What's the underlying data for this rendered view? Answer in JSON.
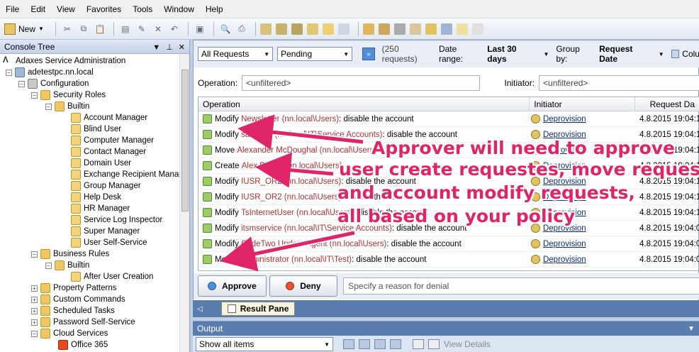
{
  "menu": [
    "File",
    "Edit",
    "View",
    "Favorites",
    "Tools",
    "Window",
    "Help"
  ],
  "toolbar": {
    "new_label": "New"
  },
  "tree": {
    "title": "Console Tree",
    "nodes": [
      "Adaxes Service Administration",
      "adetestpc.nn.local",
      "Configuration",
      "Security Roles",
      "Builtin",
      "Account Manager",
      "Blind User",
      "Computer Manager",
      "Contact Manager",
      "Domain User",
      "Exchange Recipient Manage",
      "Group Manager",
      "Help Desk",
      "HR Manager",
      "Service Log Inspector",
      "Super Manager",
      "User Self-Service",
      "Business Rules",
      "Builtin",
      "After User Creation",
      "Property Patterns",
      "Custom Commands",
      "Scheduled Tasks",
      "Password Self-Service",
      "Cloud Services",
      "Office 365"
    ]
  },
  "filter": {
    "requests_select": "All Requests",
    "status_select": "Pending",
    "count": "(250 requests)",
    "date_range_label": "Date range:",
    "date_range_value": "Last 30 days",
    "group_by_label": "Group by:",
    "group_by_value": "Request Date",
    "columns_label": "Colu",
    "operation_label": "Operation:",
    "operation_value": "<unfiltered>",
    "initiator_label": "Initiator:",
    "initiator_value": "<unfiltered>"
  },
  "grid": {
    "headers": [
      "Operation",
      "Initiator",
      "Request Da"
    ],
    "rows": [
      {
        "verb": "Modify",
        "obj": "Newsletter (nn.local\\Users)",
        "rest": ": disable the account",
        "initiator": "Deprovision",
        "date": "4.8.2015 19:04:1"
      },
      {
        "verb": "Modify",
        "obj": "saratuch (nn.local\\IT\\Service Accounts)",
        "rest": ": disable the account",
        "initiator": "Deprovision",
        "date": "4.8.2015 19:04:1"
      },
      {
        "verb": "Move",
        "obj": "Alexander McDoughal (nn.local\\Users)",
        "rest": ": to ...",
        "initiator": "Deprovision",
        "date": "4.8.2015 19:04:1"
      },
      {
        "verb": "Create",
        "obj": "Alex Brown (nn.local\\Users)",
        "rest": "",
        "initiator": "Deprovision",
        "date": "4.8.2015 19:04:1"
      },
      {
        "verb": "Modify",
        "obj": "IUSR_OR2 (nn.local\\Users)",
        "rest": ": disable the account",
        "initiator": "Deprovision",
        "date": "4.8.2015 19:04:1"
      },
      {
        "verb": "Modify",
        "obj": "IUSR_OR2 (nn.local\\Users)",
        "rest": ": disable the account",
        "initiator": "Deprovision",
        "date": "4.8.2015 19:04:1"
      },
      {
        "verb": "Modify",
        "obj": "TsInternetUser (nn.local\\Users)",
        "rest": ": disable the account",
        "initiator": "Deprovision",
        "date": "4.8.2015 19:04:1"
      },
      {
        "verb": "Modify",
        "obj": "itsmservice (nn.local\\IT\\Service Accounts)",
        "rest": ": disable the account",
        "initiator": "Deprovision",
        "date": "4.8.2015 19:04:0"
      },
      {
        "verb": "Modify",
        "obj": "CodeTwo Update Agent (nn.local\\Users)",
        "rest": ": disable the account",
        "initiator": "Deprovision",
        "date": "4.8.2015 19:04:0"
      },
      {
        "verb": "Modify",
        "obj": "Administrator (nn.local\\IT\\Test)",
        "rest": ": disable the account",
        "initiator": "Deprovision",
        "date": "4.8.2015 19:04:0"
      }
    ]
  },
  "actions": {
    "approve": "Approve",
    "deny": "Deny",
    "reason_placeholder": "Specify a reason for denial"
  },
  "result_tab": "Result Pane",
  "output": {
    "title": "Output",
    "filter": "Show all items",
    "view_details": "View Details"
  },
  "annotation": {
    "lines": [
      "Approver will need to approve",
      "user create requestes, move requests",
      "and account modify requests,",
      "all based on your policy"
    ],
    "color": "#e0246a"
  }
}
